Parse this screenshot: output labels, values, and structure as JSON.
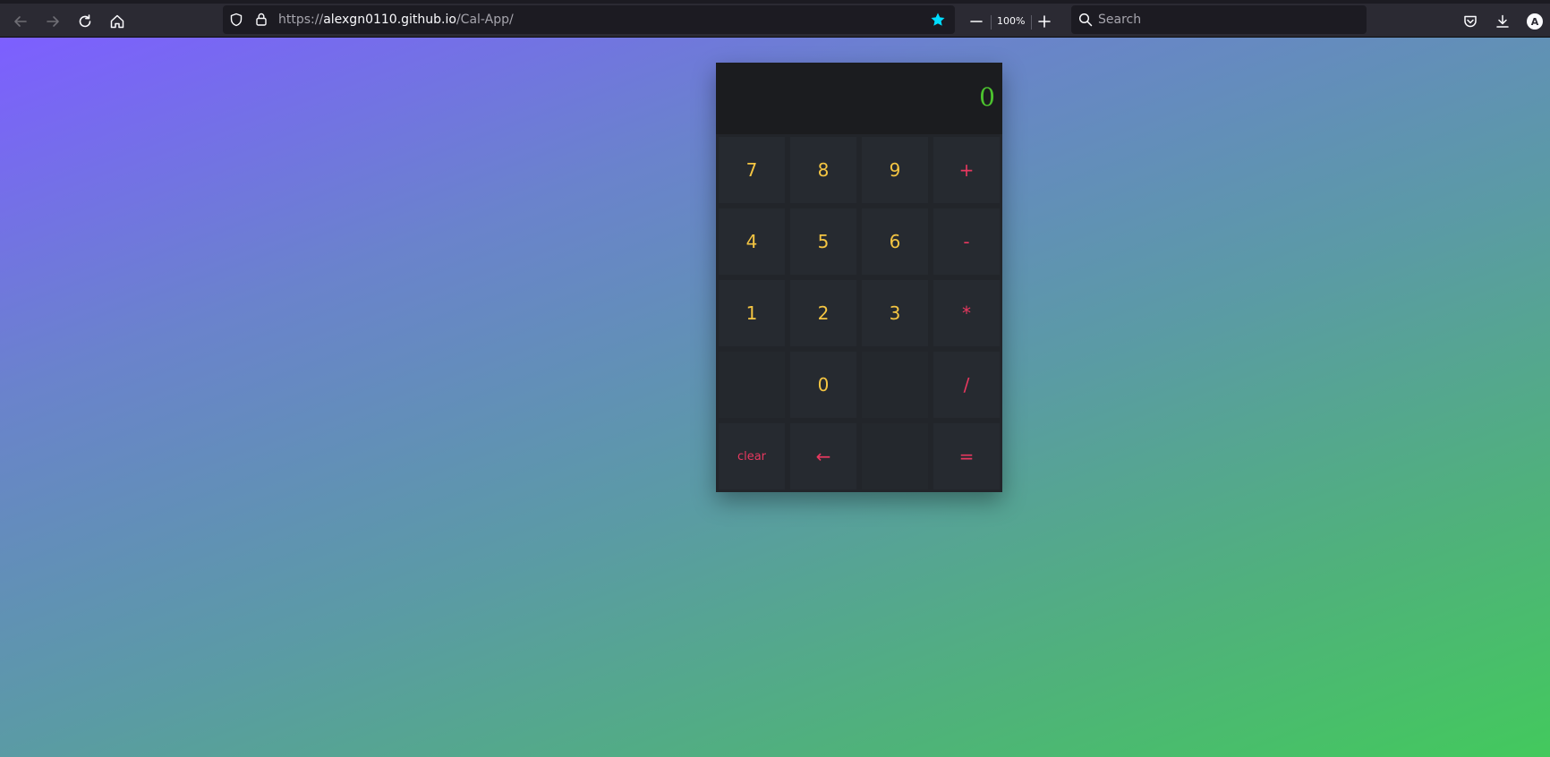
{
  "browser": {
    "url_prefix": "https://",
    "url_host": "alexgn0110.github.io",
    "url_path": "/Cal-App/",
    "zoom": "100%",
    "search_placeholder": "Search",
    "profile_initial": "A",
    "accent_color": "#00ddff"
  },
  "calculator": {
    "display": "0",
    "display_color": "#4cc22e",
    "number_color": "#f4c542",
    "operator_color": "#e8385f",
    "rows": [
      [
        {
          "label": "7",
          "kind": "num",
          "name": "key-7"
        },
        {
          "label": "8",
          "kind": "num",
          "name": "key-8"
        },
        {
          "label": "9",
          "kind": "num",
          "name": "key-9"
        },
        {
          "label": "+",
          "kind": "op",
          "name": "key-plus"
        }
      ],
      [
        {
          "label": "4",
          "kind": "num",
          "name": "key-4"
        },
        {
          "label": "5",
          "kind": "num",
          "name": "key-5"
        },
        {
          "label": "6",
          "kind": "num",
          "name": "key-6"
        },
        {
          "label": "-",
          "kind": "op",
          "name": "key-minus"
        }
      ],
      [
        {
          "label": "1",
          "kind": "num",
          "name": "key-1"
        },
        {
          "label": "2",
          "kind": "num",
          "name": "key-2"
        },
        {
          "label": "3",
          "kind": "num",
          "name": "key-3"
        },
        {
          "label": "*",
          "kind": "op",
          "name": "key-multiply"
        }
      ],
      [
        {
          "label": "",
          "kind": "blank",
          "name": "key-blank"
        },
        {
          "label": "0",
          "kind": "num",
          "name": "key-0"
        },
        {
          "label": "",
          "kind": "blank",
          "name": "key-blank"
        },
        {
          "label": "/",
          "kind": "op",
          "name": "key-divide"
        }
      ],
      [
        {
          "label": "clear",
          "kind": "op",
          "name": "key-clear"
        },
        {
          "label": "←",
          "kind": "op",
          "name": "key-backspace"
        },
        {
          "label": "",
          "kind": "blank",
          "name": "key-blank"
        },
        {
          "label": "=",
          "kind": "op",
          "name": "key-equals"
        }
      ]
    ]
  }
}
